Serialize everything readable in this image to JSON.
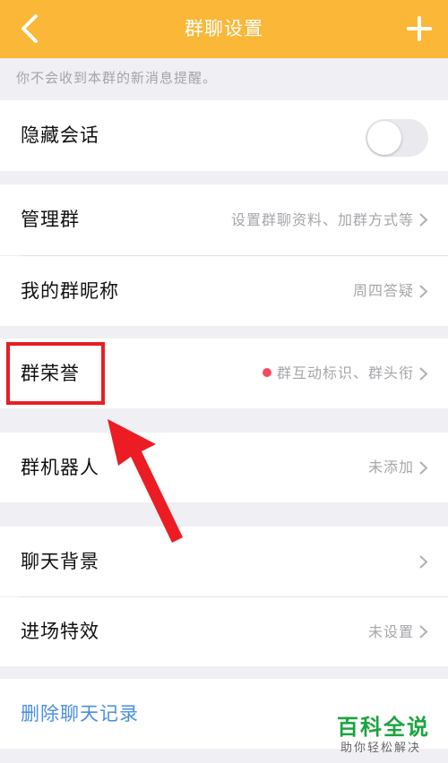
{
  "header": {
    "title": "群聊设置",
    "back_icon": "chevron-left-icon",
    "add_icon": "plus-icon",
    "background": "#fbb738"
  },
  "notice": "你不会收到本群的新消息提醒。",
  "hide_chat": {
    "label": "隐藏会话",
    "enabled": false
  },
  "group_manage": {
    "manage": {
      "label": "管理群",
      "value": "设置群聊资料、加群方式等"
    },
    "nickname": {
      "label": "我的群昵称",
      "value": "周四答疑"
    }
  },
  "group_honor": {
    "label": "群荣誉",
    "value": "群互动标识、群头衔",
    "has_red_dot": true
  },
  "group_robot": {
    "label": "群机器人",
    "value": "未添加"
  },
  "chat_bg": {
    "background": {
      "label": "聊天背景"
    },
    "entry_effect": {
      "label": "进场特效",
      "value": "未设置"
    }
  },
  "delete_history": {
    "label": "删除聊天记录",
    "color": "#4a8fe0"
  },
  "annotation": {
    "highlight_color": "#e91d23"
  },
  "watermark": {
    "title": "百科全说",
    "subtitle": "助你轻松解决",
    "color": "#1aa43f"
  }
}
